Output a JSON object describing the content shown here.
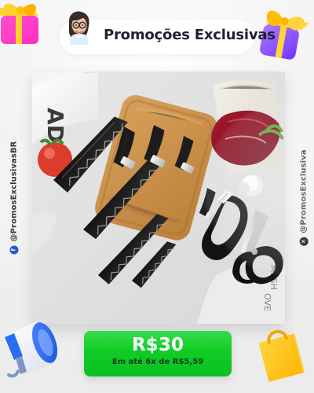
{
  "header": {
    "title": "Promoções Exclusivas",
    "avatar_icon": "woman-avatar-icon"
  },
  "decorations": {
    "left_gift_icon": "gift-icon",
    "right_gift_icon": "gift-icon",
    "megaphone_icon": "megaphone-icon",
    "shopping_bag_icon": "shopping-bag-icon"
  },
  "social": {
    "left_handle": "@PromosExclusivasBR",
    "right_handle": "@PromosExclusiva",
    "left_platform_icon": "facebook-icon",
    "right_platform_icon": "x-icon"
  },
  "hero": {
    "tag_text": "ADE",
    "image_subject": "black kitchen knife set with scissors and peeler"
  },
  "price_box": {
    "price": "R$30",
    "installments": "Em até 6x de R$5,59",
    "accent_color": "#13d52a"
  }
}
